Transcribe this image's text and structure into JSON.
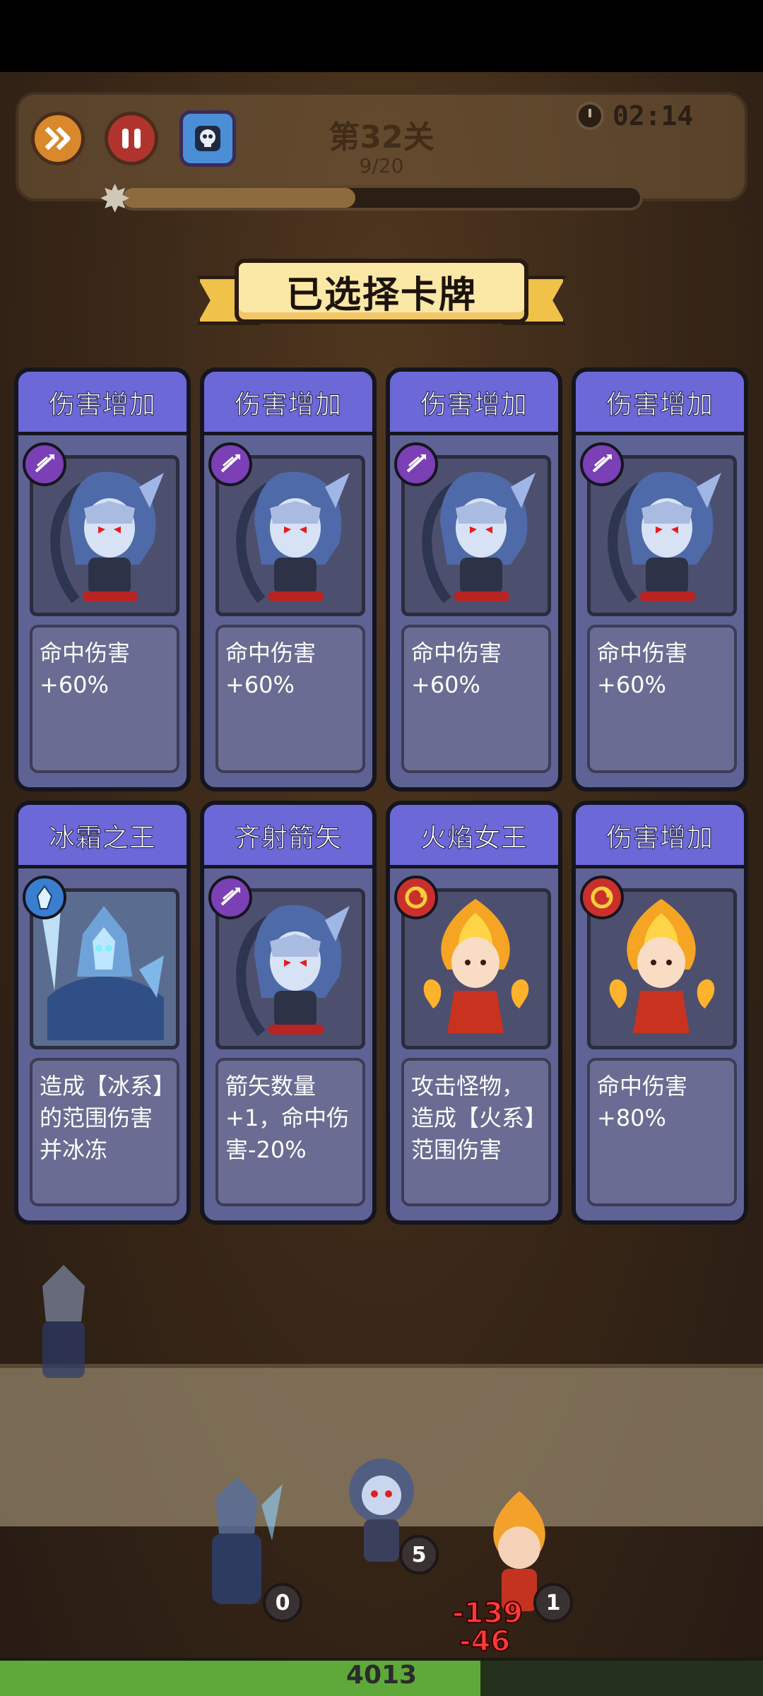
{
  "hud": {
    "level_title": "第32关",
    "wave_progress": "9/20",
    "wave_fraction": 0.45,
    "timer": "02:14",
    "icons": {
      "speed": "fast-forward-icon",
      "pause": "pause-icon",
      "card_deck": "skull-card-icon",
      "clock": "clock-icon"
    }
  },
  "panel": {
    "banner_title": "已选择卡牌"
  },
  "cards": [
    {
      "title": "伤害增加",
      "type": "arrow",
      "hero": "archer",
      "desc": "命中伤害+60%"
    },
    {
      "title": "伤害增加",
      "type": "arrow",
      "hero": "archer",
      "desc": "命中伤害+60%"
    },
    {
      "title": "伤害增加",
      "type": "arrow",
      "hero": "archer",
      "desc": "命中伤害+60%"
    },
    {
      "title": "伤害增加",
      "type": "arrow",
      "hero": "archer",
      "desc": "命中伤害+60%"
    },
    {
      "title": "冰霜之王",
      "type": "ice",
      "hero": "ice-knight",
      "desc": "造成【冰系】的范围伤害并冰冻"
    },
    {
      "title": "齐射箭矢",
      "type": "arrow",
      "hero": "archer",
      "desc": "箭矢数量+1，命中伤害-20%"
    },
    {
      "title": "火焰女王",
      "type": "fire",
      "hero": "fire-queen",
      "desc": "攻击怪物，造成【火系】范围伤害"
    },
    {
      "title": "伤害增加",
      "type": "fire",
      "hero": "fire-queen",
      "desc": "命中伤害+80%"
    }
  ],
  "battlefield": {
    "heroes": [
      {
        "name": "ice-knight",
        "level": "0"
      },
      {
        "name": "archer",
        "level": "5"
      },
      {
        "name": "fire-queen",
        "level": "1"
      }
    ],
    "damage_numbers": [
      "-139",
      "-46"
    ],
    "base_hp": "4013",
    "base_hp_fraction": 0.63
  },
  "colors": {
    "card_header": "#6c68d8",
    "card_body": "#5f6294",
    "banner": "#fbe7a6",
    "arrow_type": "#7b3fb6",
    "ice_type": "#3a7ed0",
    "fire_type": "#c9302c",
    "hp_bar": "#5fa93a"
  }
}
